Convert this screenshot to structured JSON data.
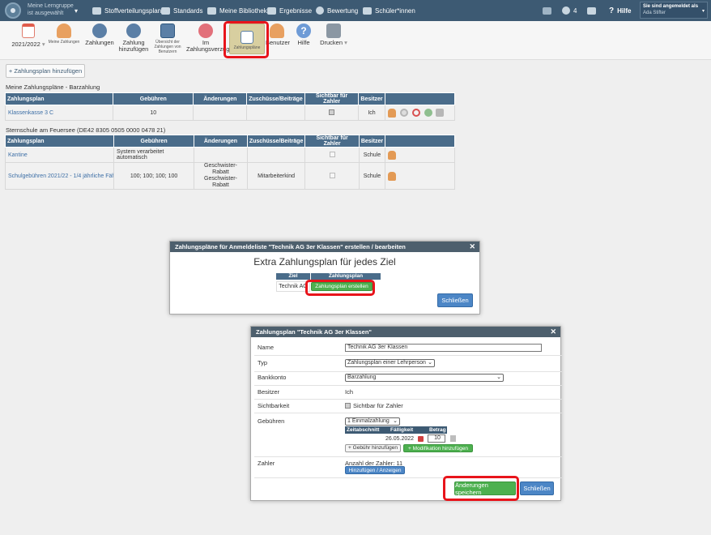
{
  "header": {
    "group_line1": "Meine Lerngruppe",
    "group_line2": "ist ausgewählt",
    "nav": [
      "Stoffverteilungsplan",
      "Standards",
      "Meine Bibliothek",
      "Ergebnisse",
      "Bewertung",
      "Schüler*innen"
    ],
    "message_count": "4",
    "help": "Hilfe",
    "login_line1": "Sie sind angemeldet als",
    "login_line2": "Ada Stifter"
  },
  "toolbar": {
    "year": "2021/2022",
    "items": [
      "Meine Zahlungen",
      "Zahlungen",
      "Zahlung hinzufügen",
      "Übersicht der Zahlungen von Benutzern",
      "Im Zahlungsverzug",
      "Zahlungspläne",
      "Benutzer",
      "Hilfe",
      "Drucken"
    ],
    "year_icon": "calendar-icon",
    "print_icon": "printer-icon"
  },
  "add_plan_button": "+ Zahlungsplan hinzufügen",
  "table_headers": [
    "Zahlungsplan",
    "Gebühren",
    "Änderungen",
    "Zuschüsse/Beiträge",
    "Sichtbar für Zahler",
    "Besitzer"
  ],
  "section1": {
    "title": "Meine Zahlungspläne - Barzahlung",
    "rows": [
      {
        "plan": "Klassenkasse 3 C",
        "fees": "10",
        "changes": "",
        "subsidies": "",
        "owner": "Ich"
      }
    ]
  },
  "section2": {
    "title": "Sternschule am Feuersee (DE42 8305 0505 0000 0478 21)",
    "rows": [
      {
        "plan": "Kantine",
        "fees": "System verarbeitet automatisch",
        "changes": "",
        "subsidies": "",
        "owner": "Schule"
      },
      {
        "plan": "Schulgebühren 2021/22 - 1/4 jährliche Fäh",
        "fees": "100; 100; 100; 100",
        "changes1": "Geschwister-Rabatt",
        "changes2": "Geschwister-Rabatt",
        "subsidies": "Mitarbeiterkind",
        "owner": "Schule"
      }
    ]
  },
  "dialog1": {
    "title": "Zahlungspläne für Anmeldeliste \"Technik AG 3er Klassen\" erstellen / bearbeiten",
    "heading": "Extra Zahlungsplan für jedes Ziel",
    "col_goal": "Ziel",
    "col_plan": "Zahlungsplan",
    "goal": "Technik AG",
    "create_button": "Zahlungsplan erstellen",
    "close_button": "Schließen"
  },
  "dialog2": {
    "title": "Zahlungsplan \"Technik AG 3er Klassen\"",
    "labels": {
      "name": "Name",
      "type": "Typ",
      "bank": "Bankkonto",
      "owner": "Besitzer",
      "visibility": "Sichtbarkeit",
      "fees": "Gebühren",
      "payers": "Zahler"
    },
    "name_value": "Technik AG 3er Klassen",
    "type_value": "Zahlungsplan einer Lehrperson",
    "bank_value": "Barzahlung",
    "owner_value": "Ich",
    "visibility_label": "Sichtbar für Zahler",
    "fees_select": "1 Einmalzahlung",
    "fee_headers": [
      "Zeitabschnitt",
      "Fälligkeit",
      "Betrag"
    ],
    "due_date": "26.05.2022",
    "amount": "10",
    "add_fee_button": "+ Gebühr hinzufügen",
    "add_mod_button": "+ Modifikation hinzufügen",
    "payer_count": "Anzahl der Zahler: 11",
    "payer_button": "Hinzufügen / Anzeigen",
    "save_button": "Änderungen speichern",
    "close_button": "Schließen"
  }
}
